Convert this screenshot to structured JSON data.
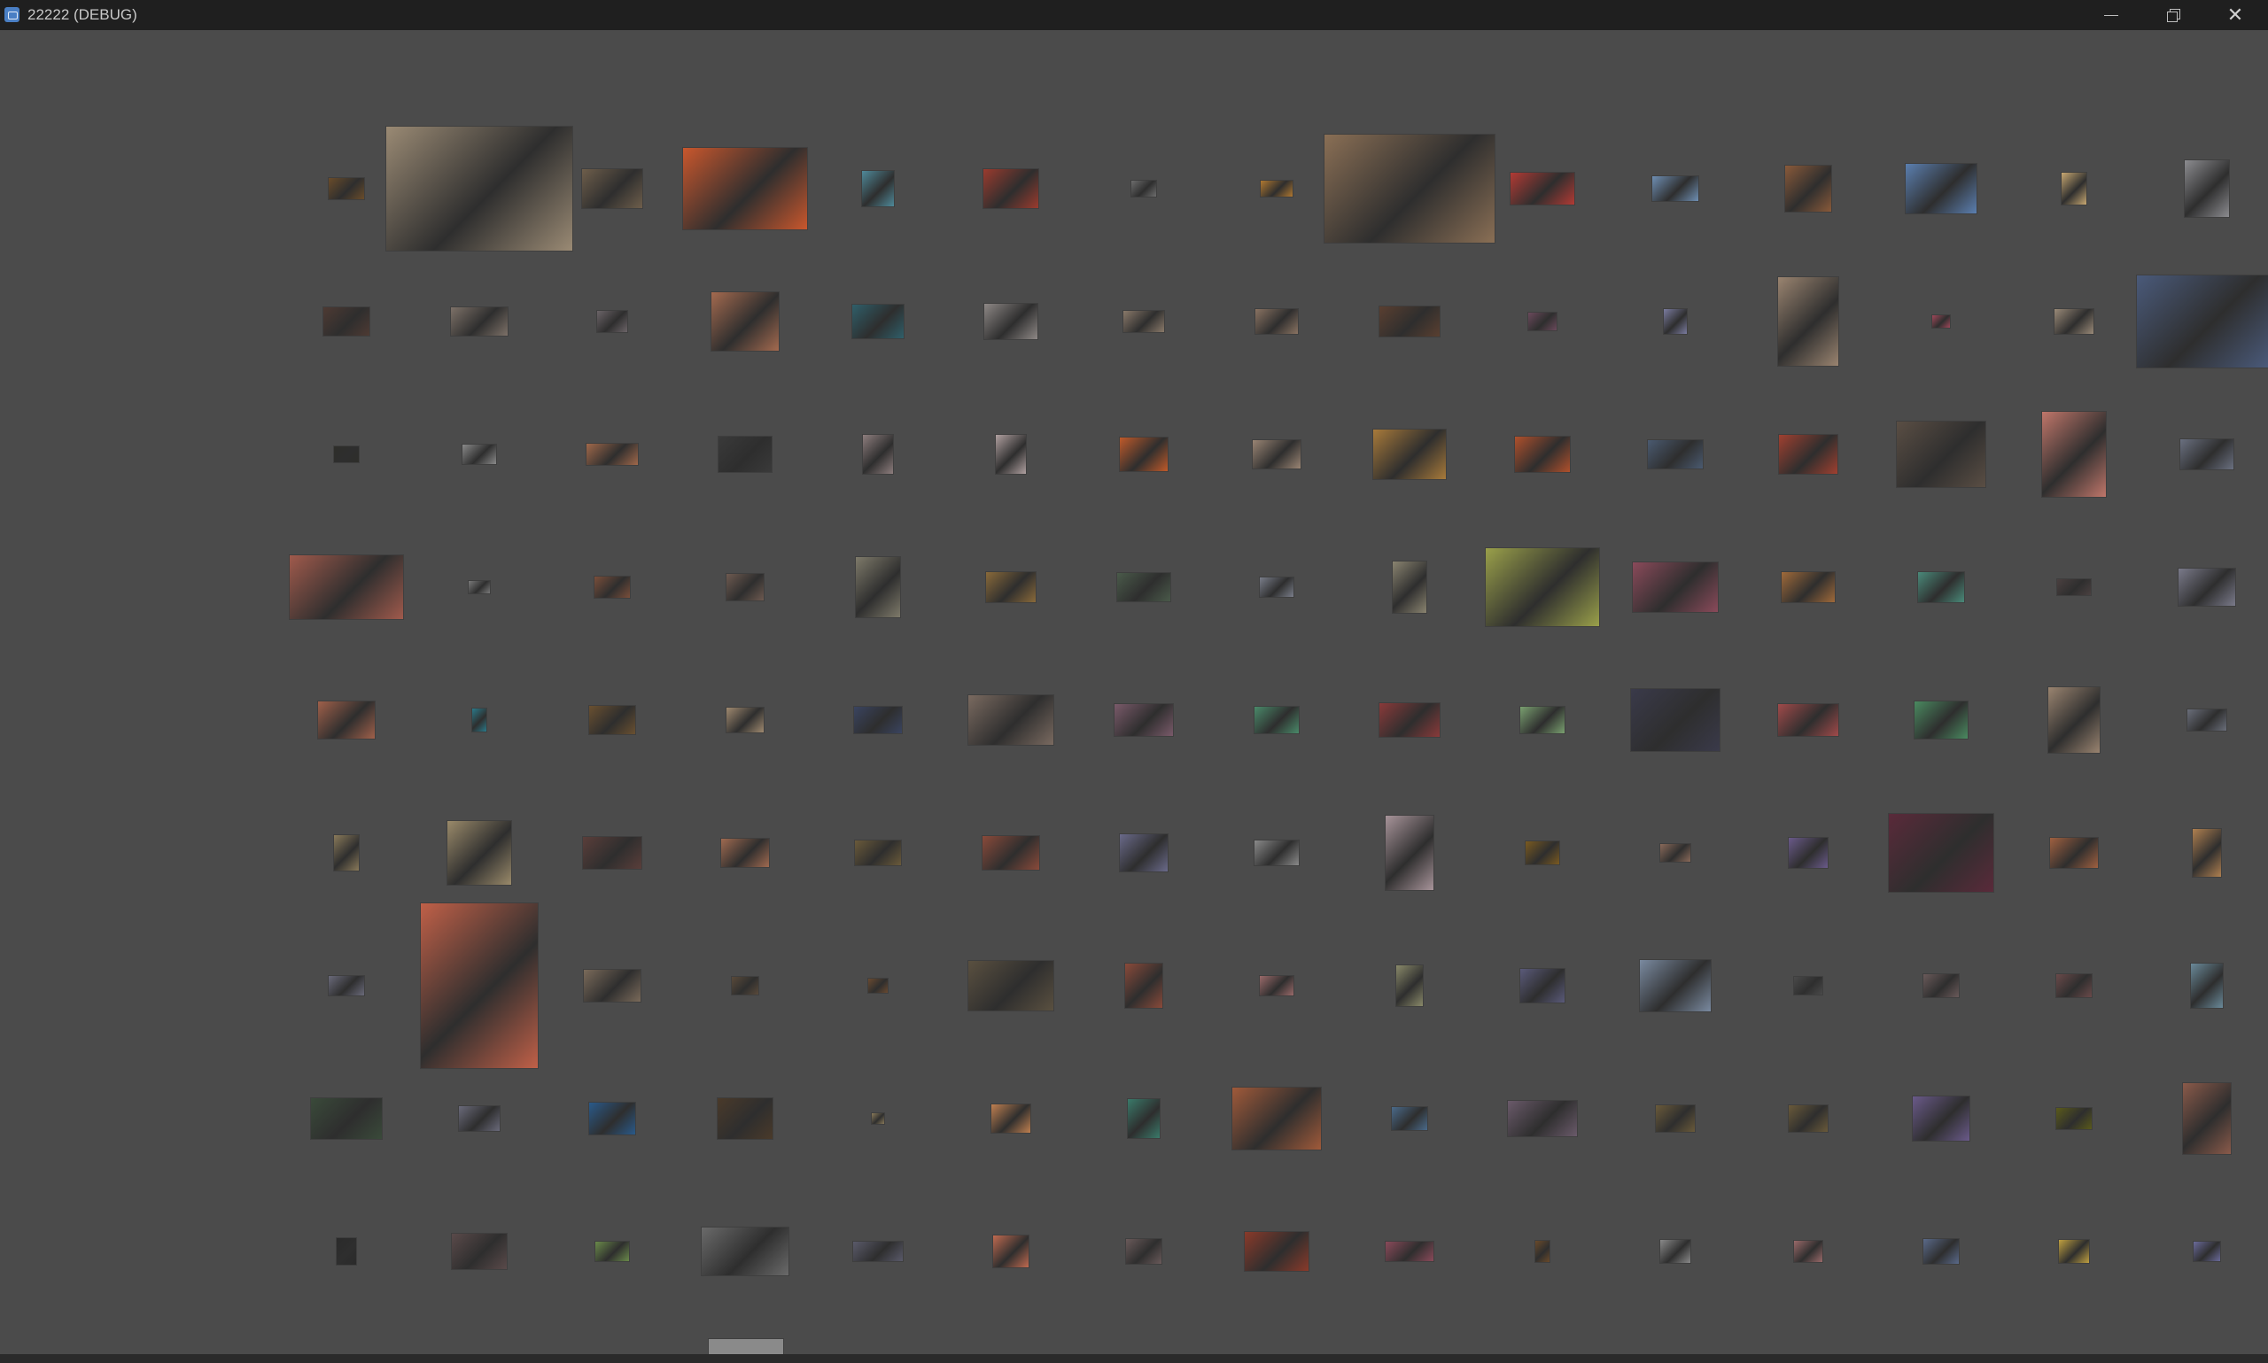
{
  "window": {
    "title": "22222 (DEBUG)",
    "icons": {
      "app": "app-icon",
      "minimize": "minimize-icon",
      "maximize": "maximize-icon",
      "close": "close-icon"
    }
  },
  "gallery": {
    "rows": 9,
    "columns": 15,
    "photos": [
      [
        "#6a4c2a",
        "#9a8a74",
        "#6e5e4b",
        "#c9572d",
        "#4f8a9a",
        "#9b3b2e",
        "#6d6d6d",
        "#b07830",
        "#8a6f55",
        "#b23a34",
        "#6f8fb3",
        "#8a5a3a",
        "#5b7fb0",
        "#c8a872",
        "#8c8c90"
      ],
      [
        "#4e3a33",
        "#7d7168",
        "#6c6468",
        "#a46a4f",
        "#2f5f6a",
        "#8e8886",
        "#8a7a6a",
        "#8a7362",
        "#5a3f30",
        "#6b4a5c",
        "#7b7ca0",
        "#9a8470",
        "#a0485a",
        "#9a8a78",
        "#4a5a7a"
      ],
      [
        "#2e2e2a",
        "#8a8a8a",
        "#a0684a",
        "#3a3a3a",
        "#8e7e7e",
        "#b0a0a0",
        "#c05a2a",
        "#9a8574",
        "#a87a3a",
        "#b0502c",
        "#4a5a70",
        "#a04030",
        "#5a4e44",
        "#c0766a",
        "#6a7080"
      ],
      [
        "#a05a4c",
        "#7a7a7a",
        "#7a4e3a",
        "#6e5a50",
        "#7e7a6a",
        "#8a6a3a",
        "#4a5a4a",
        "#7a7e8a",
        "#8a8470",
        "#9aa04a",
        "#8a4a5a",
        "#a06a3a",
        "#4a8a7a",
        "#4a4040",
        "#7a7a8a"
      ],
      [
        "#a0604a",
        "#2a7a8a",
        "#6a5030",
        "#a08a70",
        "#3a4460",
        "#7a6a60",
        "#7a5a6a",
        "#4a8a6a",
        "#8a3a3a",
        "#7aa070",
        "#3a3a4a",
        "#a04a4a",
        "#4a8a60",
        "#9a8470",
        "#6a6e7a"
      ],
      [
        "#8a7a5a",
        "#9a8a6a",
        "#5a3e3a",
        "#a06a50",
        "#6a5a3a",
        "#8a4a3a",
        "#6a6a8a",
        "#8a8a8a",
        "#a8949a",
        "#7a5a20",
        "#8a6a5a",
        "#6a5a8a",
        "#5a2a3a",
        "#a06040",
        "#b08050"
      ],
      [
        "#6a6a7a",
        "#c06048",
        "#7a6a5a",
        "#5a4a3a",
        "#6a4a30",
        "#5a5040",
        "#8a4a3a",
        "#9a6a6a",
        "#8a8a6a",
        "#5a5a7a",
        "#7a8aa0",
        "#4a4a4a",
        "#6a5a5a",
        "#6a4a4a",
        "#6a8a9a"
      ],
      [
        "#3a4a3a",
        "#6a6a7a",
        "#2a5a8a",
        "#4a3a2a",
        "#8a7a5a",
        "#c08050",
        "#3a7a6a",
        "#a05a3a",
        "#4a6a8a",
        "#6a5a6a",
        "#6a5a3a",
        "#6a5a3a",
        "#6a5a8a",
        "#5a5a1a",
        "#8a5a4a"
      ],
      [
        "#2a2a2a",
        "#5a4a4a",
        "#6a8a4a",
        "#6a6a6a",
        "#5a5a6a",
        "#c06a50",
        "#6a5a5a",
        "#8a3a2a",
        "#8a4a5a",
        "#6a4a2a",
        "#8a8a8a",
        "#9a6a6a",
        "#5a6a8a",
        "#c0a040",
        "#6a6a9a"
      ]
    ],
    "bottom_peek_color": "#8a8a8a"
  }
}
